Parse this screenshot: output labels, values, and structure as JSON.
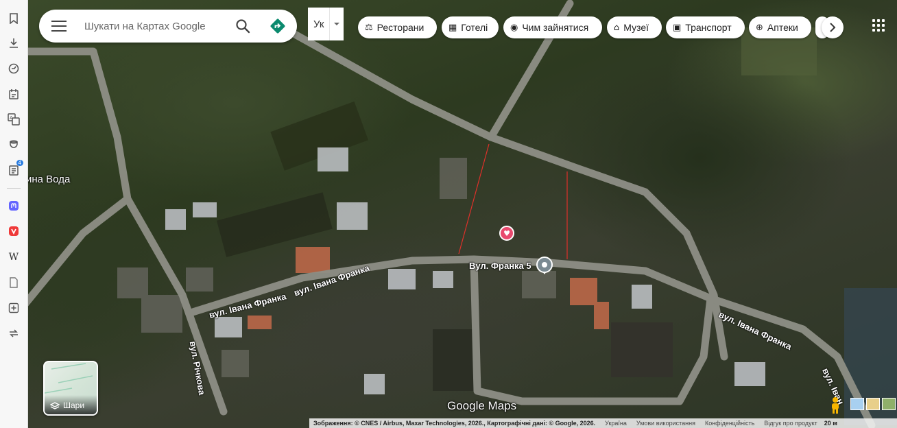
{
  "sidebar": {
    "icons": [
      "bookmark-icon",
      "download-icon",
      "history-icon",
      "notes-icon",
      "translate-icon",
      "reading-icon",
      "mail-icon",
      "mastodon-icon",
      "vivaldi-icon",
      "wikipedia-icon",
      "document-icon",
      "add-panel-icon",
      "sync-icon"
    ],
    "mail_badge": "4",
    "wiki_glyph": "W"
  },
  "search": {
    "placeholder": "Шукати на Картах Google"
  },
  "input_tool": {
    "label": "Ук"
  },
  "chips": [
    {
      "label": "Ресторани",
      "icon": "restaurant-icon"
    },
    {
      "label": "Готелі",
      "icon": "hotel-icon"
    },
    {
      "label": "Чим зайнятися",
      "icon": "camera-icon"
    },
    {
      "label": "Музеї",
      "icon": "museum-icon"
    },
    {
      "label": "Транспорт",
      "icon": "transit-icon"
    },
    {
      "label": "Аптеки",
      "icon": "pharmacy-icon"
    }
  ],
  "map": {
    "place_label": "ина Вода",
    "streets": {
      "franka_1": "вул. Івана Франка",
      "franka_2": "вул. Івана Франка",
      "franka_3": "вул. Івана Франка",
      "franka_4": "вул. Іван",
      "richkova": "вул. Річкова"
    },
    "pin_label": "Вул. Франка 5",
    "logo": "Google Maps",
    "layers_label": "Шари"
  },
  "footer": {
    "attribution": "Зображення: © CNES / Airbus, Maxar Technologies, 2026., Картографічні дані: © Google, 2026.",
    "country": "Україна",
    "terms": "Умови використання",
    "privacy": "Конфіденційність",
    "feedback": "Відгук про продукт",
    "scale": "20 м"
  },
  "colors": {
    "accent": "#0b8a6e",
    "heart": "#e84a6e",
    "road": "#8e8f86"
  }
}
